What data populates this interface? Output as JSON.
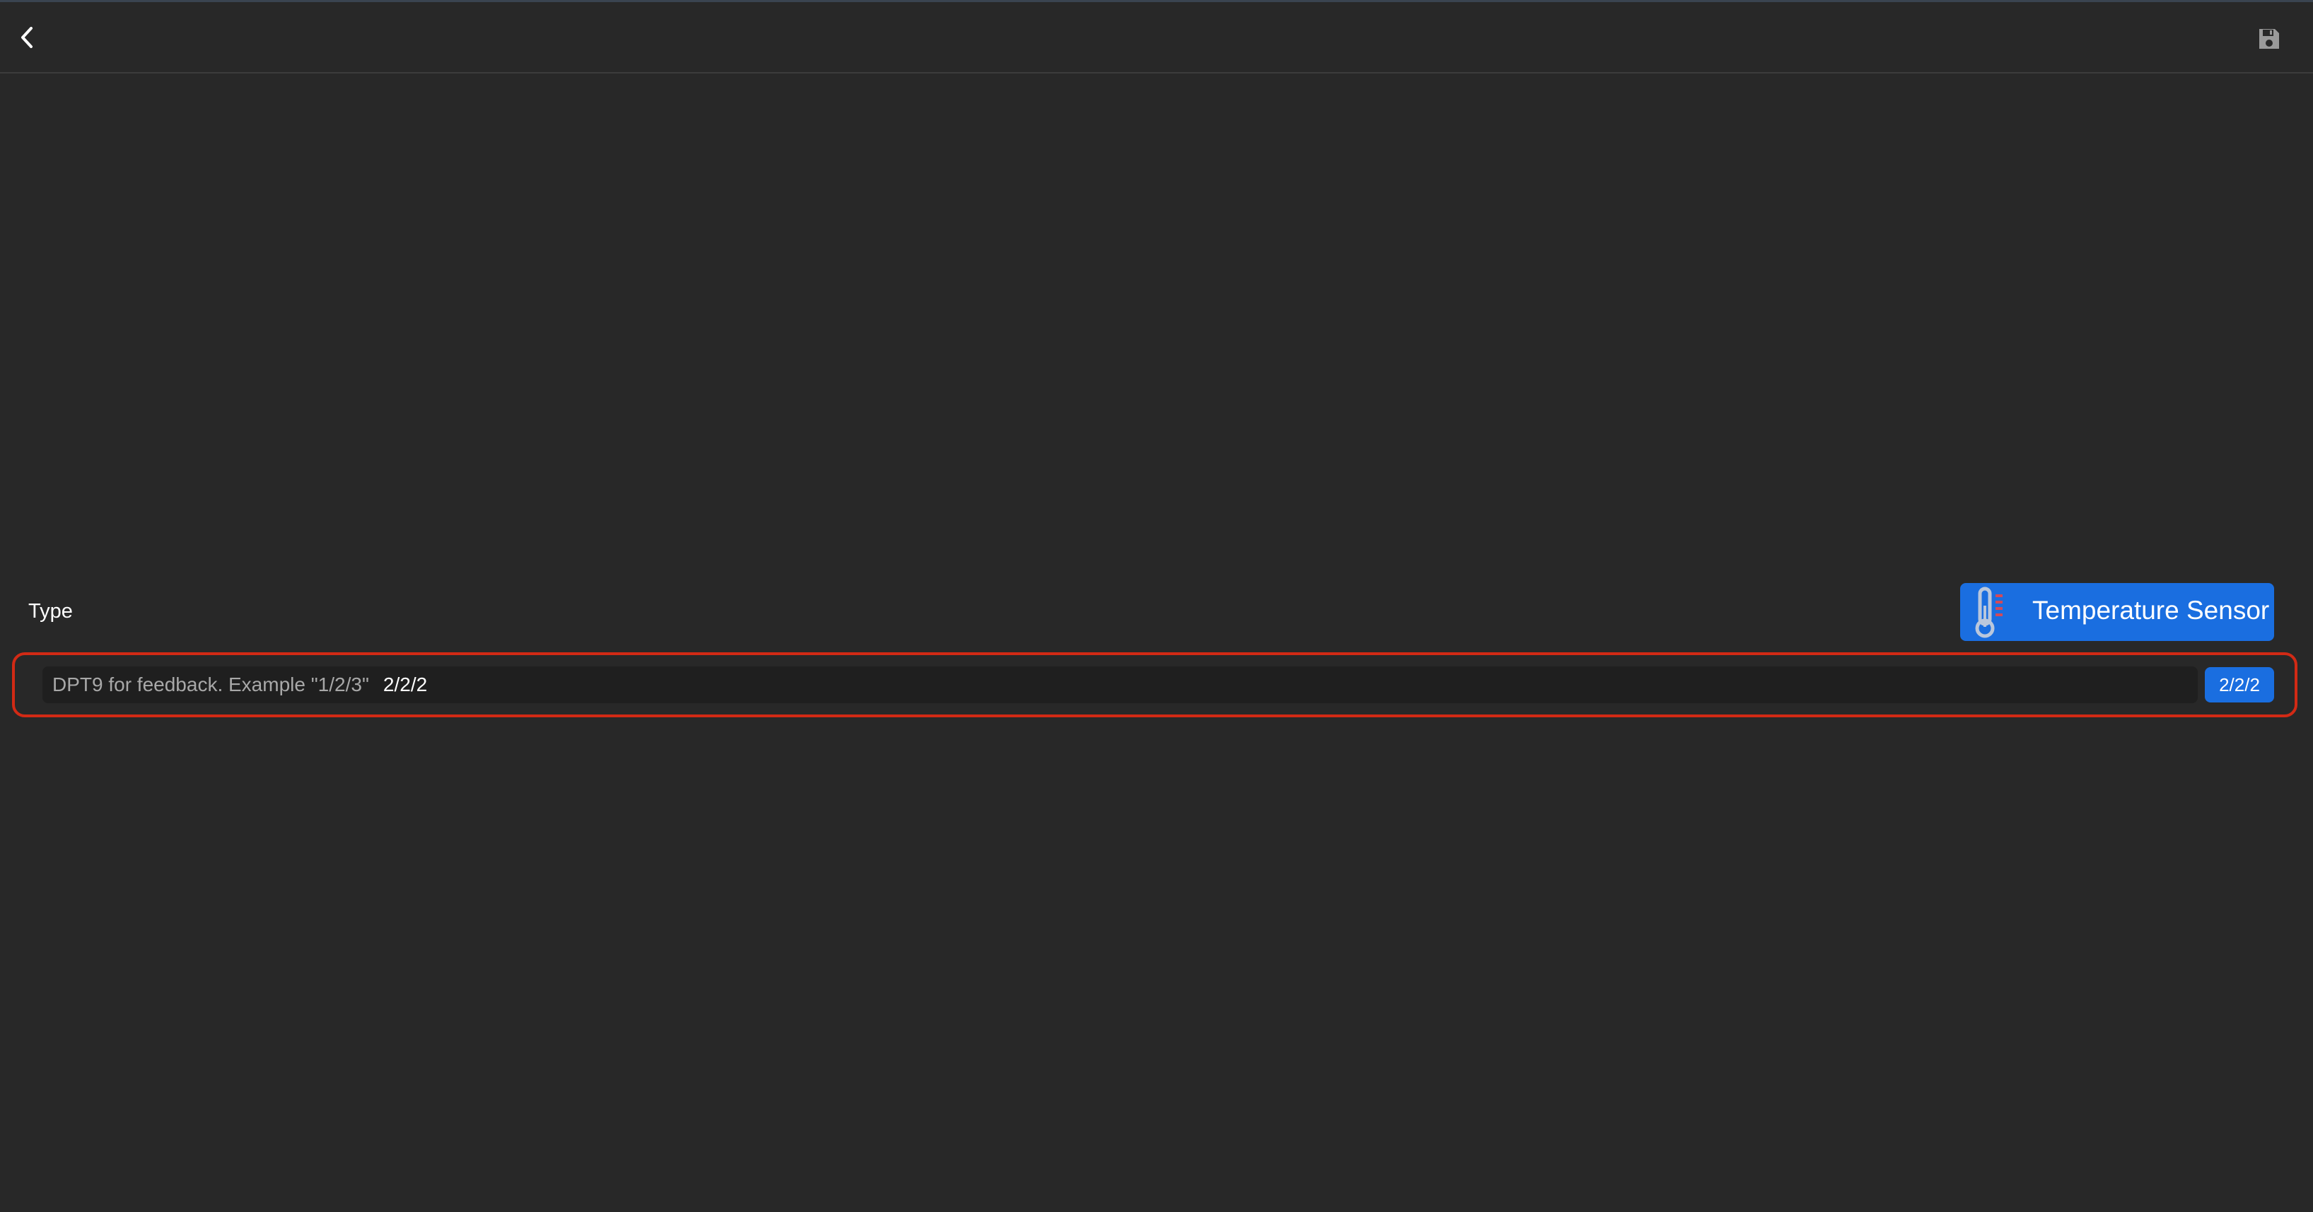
{
  "header": {
    "back_icon": "chevron-left-icon",
    "save_icon": "floppy-disk-icon"
  },
  "type_row": {
    "label": "Type",
    "button_label": "Temperature Sensor",
    "button_icon": "thermometer-icon"
  },
  "feedback_field": {
    "label": "DPT9 for feedback. Example \"1/2/3\"",
    "value": "2/2/2",
    "badge": "2/2/2"
  },
  "colors": {
    "background": "#282828",
    "accent": "#1a6ee0",
    "highlight": "#d22a15",
    "thermometer_marks": "#d24a5a"
  }
}
